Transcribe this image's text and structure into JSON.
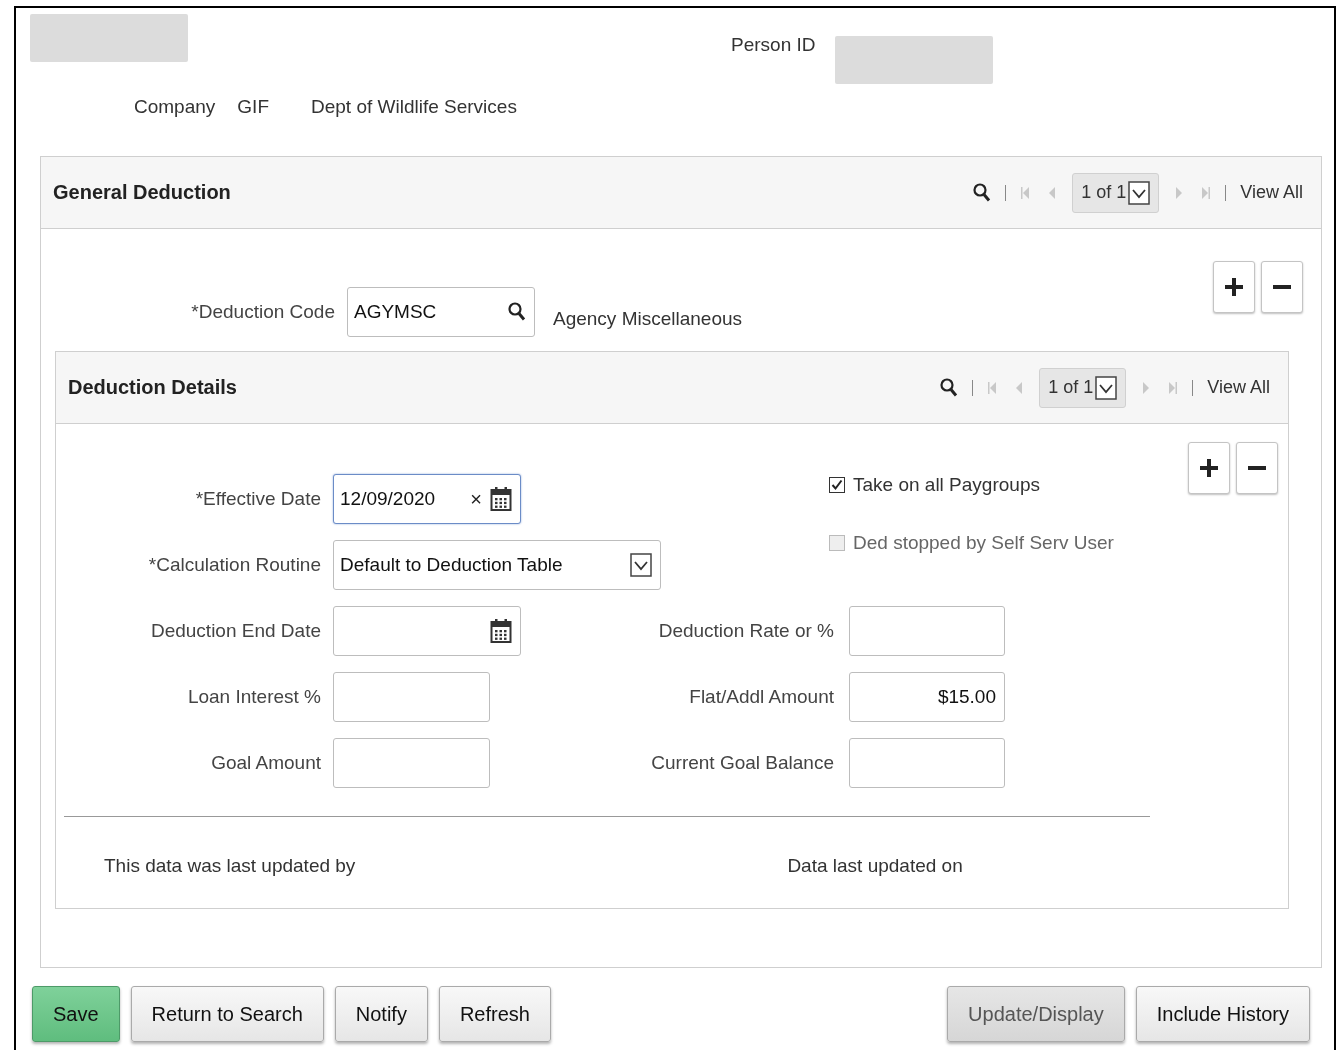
{
  "header": {
    "person_id_label": "Person ID",
    "company_label": "Company",
    "company_code": "GIF",
    "company_name": "Dept of Wildlife Services"
  },
  "general_deduction": {
    "title": "General Deduction",
    "page": "1 of 1",
    "view_all": "View All",
    "deduction_code": {
      "label": "*Deduction Code",
      "value": "AGYMSC",
      "description": "Agency Miscellaneous"
    }
  },
  "deduction_details": {
    "title": "Deduction Details",
    "page": "1 of 1",
    "view_all": "View All",
    "rows": [
      {
        "left": {
          "label": "*Effective Date",
          "kind": "date",
          "value": "12/09/2020",
          "clear_icon": "×",
          "focused": true
        },
        "right": {
          "kind": "checkbox",
          "label": "Take on all Paygroups",
          "checked": true,
          "disabled": false
        }
      },
      {
        "left": {
          "label": "*Calculation Routine",
          "kind": "select",
          "value": "Default to Deduction Table"
        },
        "right": {
          "kind": "checkbox",
          "label": "Ded stopped by Self Serv User",
          "checked": false,
          "disabled": true
        }
      },
      {
        "left": {
          "label": "Deduction End Date",
          "kind": "date",
          "focused": false
        },
        "right": {
          "kind": "text",
          "label": "Deduction Rate or %"
        }
      },
      {
        "left": {
          "label": "Loan Interest %",
          "kind": "text"
        },
        "right": {
          "kind": "text",
          "label": "Flat/Addl Amount",
          "value": "$15.00"
        }
      },
      {
        "left": {
          "label": "Goal Amount",
          "kind": "text"
        },
        "right": {
          "kind": "text",
          "label": "Current Goal Balance"
        }
      }
    ],
    "updated_by_label": "This data was last updated by",
    "updated_on_label": "Data last updated on"
  },
  "left_buttons": [
    {
      "label": "Save",
      "kind": "primary",
      "disabled": false
    },
    {
      "label": "Return to Search",
      "kind": "normal",
      "disabled": false
    },
    {
      "label": "Notify",
      "kind": "normal",
      "disabled": false
    },
    {
      "label": "Refresh",
      "kind": "normal",
      "disabled": false
    }
  ],
  "right_buttons": [
    {
      "label": "Update/Display",
      "disabled": true
    },
    {
      "label": "Include History",
      "disabled": false
    }
  ]
}
